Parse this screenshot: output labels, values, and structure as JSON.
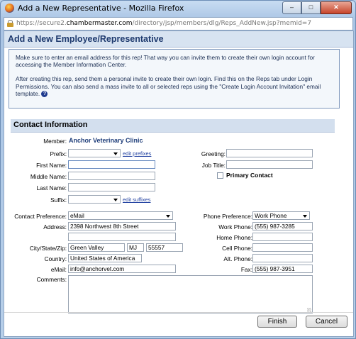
{
  "window": {
    "title": "Add a New Representative - Mozilla Firefox",
    "minimize_glyph": "–",
    "maximize_glyph": "□",
    "close_glyph": "✕"
  },
  "address_bar": {
    "url_prefix": "https://secure2.",
    "url_domain": "chambermaster.com",
    "url_path": "/directory/jsp/members/dlg/Reps_AddNew.jsp?memid=7"
  },
  "page": {
    "title": "Add a New Employee/Representative",
    "info_paragraph_1": "Make sure to enter an email address for this rep! That way you can invite them to create their own login account for accessing the Member Information Center.",
    "info_paragraph_2": "After creating this rep, send them a personal invite to create their own login. Find this on the Reps tab under Login Permissions. You can also send a mass invite to all or selected reps using the \"Create Login Account Invitation\" email template.",
    "help_glyph": "?"
  },
  "section": {
    "title": "Contact Information"
  },
  "form": {
    "member_label": "Member:",
    "member_value": "Anchor Veterinary Clinic",
    "prefix_label": "Prefix:",
    "prefix_value": "",
    "edit_prefixes": "edit prefixes",
    "first_name_label": "First Name:",
    "first_name_value": "",
    "middle_name_label": "Middle Name:",
    "middle_name_value": "",
    "last_name_label": "Last Name:",
    "last_name_value": "",
    "suffix_label": "Suffix:",
    "suffix_value": "",
    "edit_suffixes": "edit suffixes",
    "greeting_label": "Greeting:",
    "greeting_value": "",
    "job_title_label": "Job Title:",
    "job_title_value": "",
    "primary_contact_label": "Primary Contact",
    "primary_contact_checked": false,
    "contact_pref_label": "Contact Preference:",
    "contact_pref_value": "eMail",
    "address_label": "Address:",
    "address_line1": "2398 Northwest 8th Street",
    "address_line2": "",
    "city_state_zip_label": "City/State/Zip:",
    "city": "Green Valley",
    "state": "MJ",
    "zip": "55557",
    "country_label": "Country:",
    "country": "United States of America",
    "email_label": "eMail:",
    "email": "info@anchorvet.com",
    "comments_label": "Comments:",
    "comments": "",
    "phone_pref_label": "Phone Preference:",
    "phone_pref_value": "Work Phone",
    "work_phone_label": "Work Phone:",
    "work_phone": "(555) 987-3285",
    "home_phone_label": "Home Phone:",
    "home_phone": "",
    "cell_phone_label": "Cell Phone:",
    "cell_phone": "",
    "alt_phone_label": "Alt. Phone:",
    "alt_phone": "",
    "fax_label": "Fax:",
    "fax": "(555) 987-3951"
  },
  "buttons": {
    "finish": "Finish",
    "cancel": "Cancel"
  }
}
